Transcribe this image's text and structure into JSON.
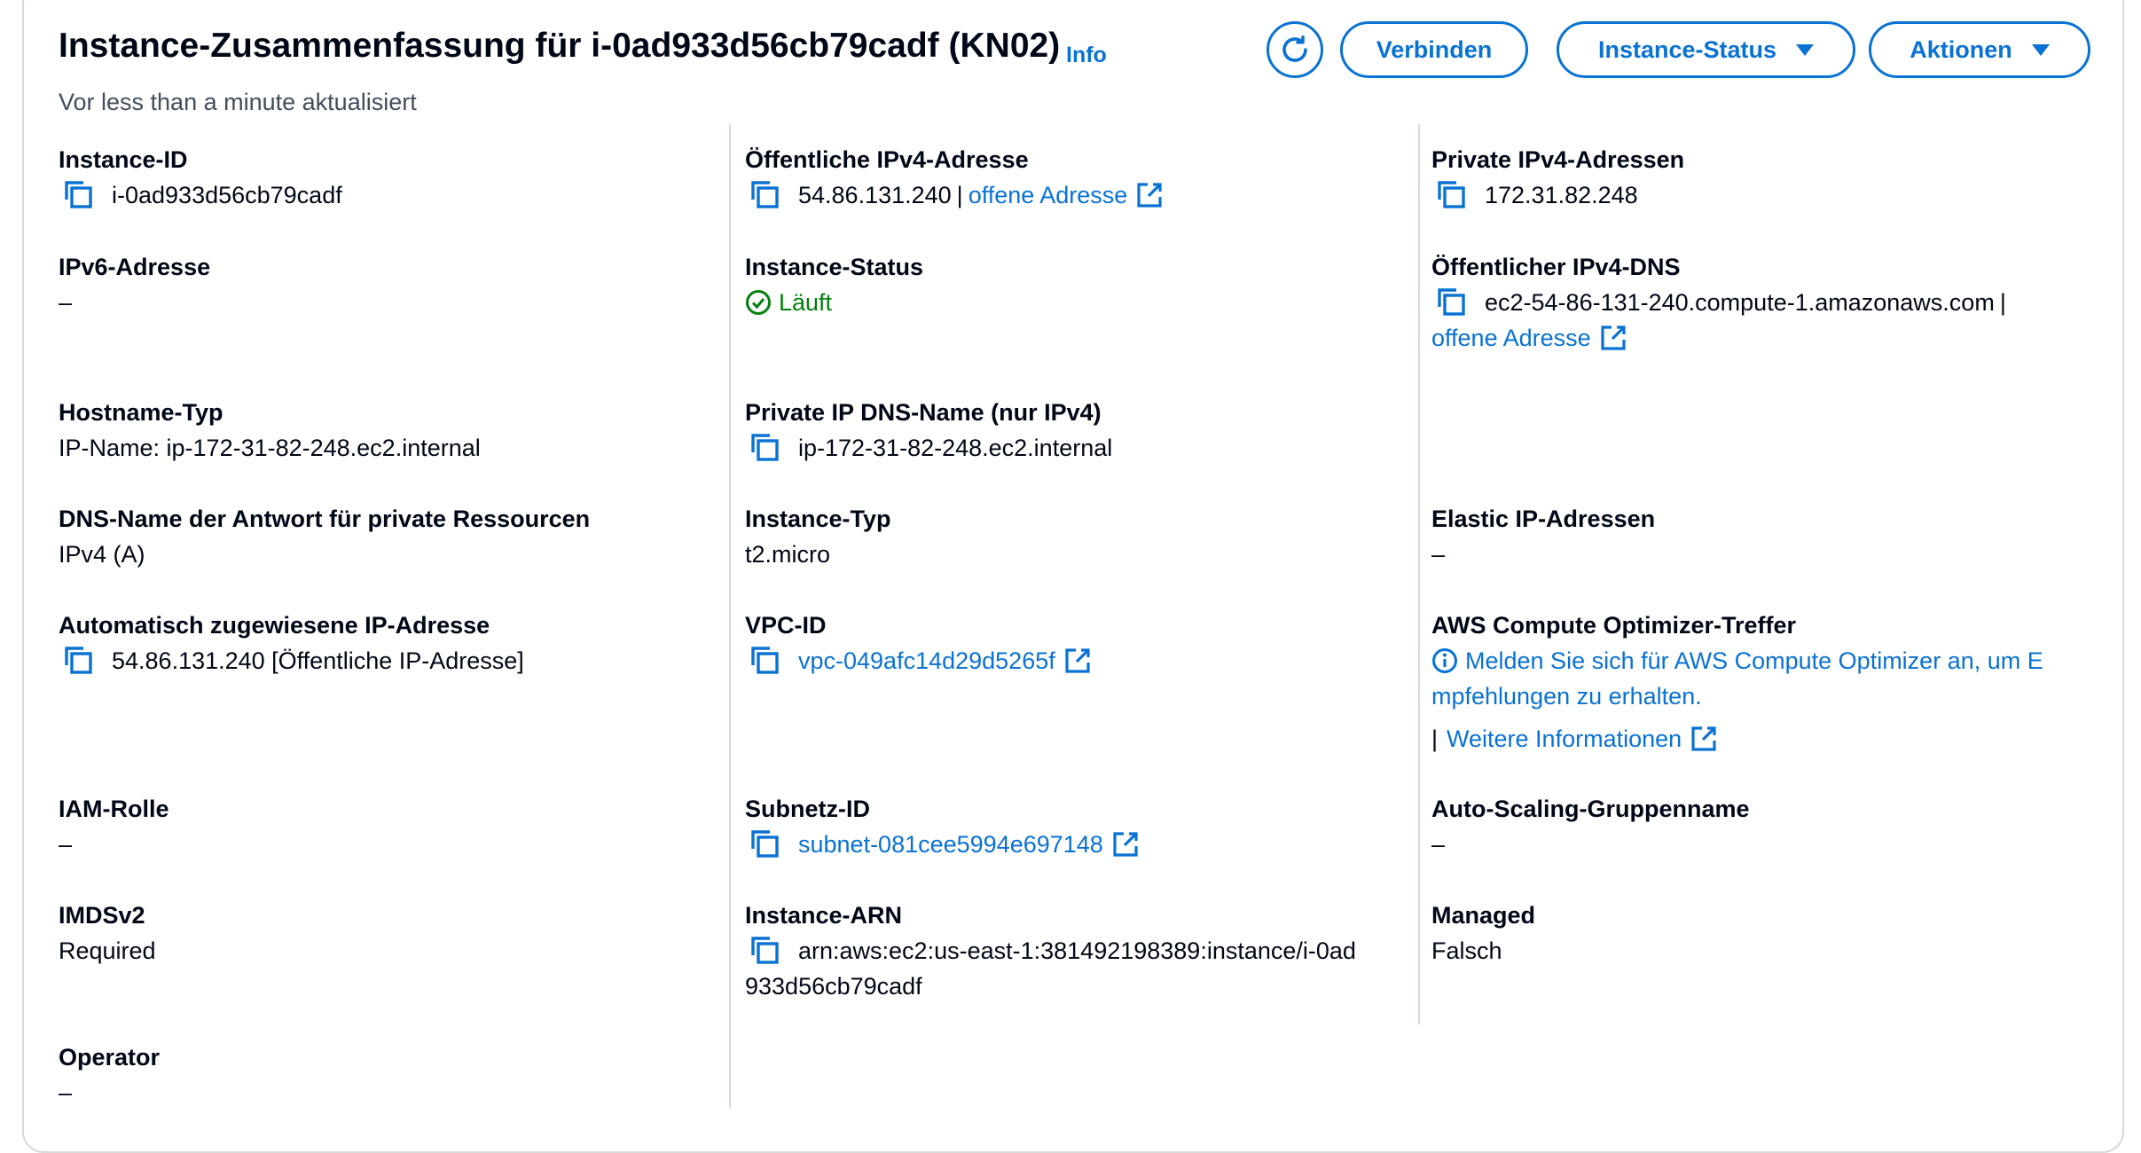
{
  "header": {
    "title": "Instance-Zusammenfassung für i-0ad933d56cb79cadf (KN02)",
    "info": "Info",
    "updated": "Vor less than a minute aktualisiert"
  },
  "actions": {
    "connect": "Verbinden",
    "instance_state": "Instance-Status",
    "actions": "Aktionen"
  },
  "col1": {
    "instance_id": {
      "label": "Instance-ID",
      "value": "i-0ad933d56cb79cadf"
    },
    "ipv6": {
      "label": "IPv6-Adresse",
      "value": "–"
    },
    "hostname_type": {
      "label": "Hostname-Typ",
      "value": "IP-Name: ip-172-31-82-248.ec2.internal"
    },
    "dns_answer": {
      "label": "DNS-Name der Antwort für private Ressourcen",
      "value": "IPv4 (A)"
    },
    "auto_ip": {
      "label": "Automatisch zugewiesene IP-Adresse",
      "value": "54.86.131.240 [Öffentliche IP-Adresse]"
    },
    "iam": {
      "label": "IAM-Rolle",
      "value": "–"
    },
    "imds": {
      "label": "IMDSv2",
      "value": "Required"
    },
    "operator": {
      "label": "Operator",
      "value": "–"
    }
  },
  "col2": {
    "public_ipv4": {
      "label": "Öffentliche IPv4-Adresse",
      "value": "54.86.131.240",
      "sep": "|",
      "link": "offene Adresse"
    },
    "instance_status": {
      "label": "Instance-Status",
      "value": "Läuft"
    },
    "private_dns": {
      "label": "Private IP DNS-Name (nur IPv4)",
      "value": "ip-172-31-82-248.ec2.internal"
    },
    "instance_type": {
      "label": "Instance-Typ",
      "value": "t2.micro"
    },
    "vpc": {
      "label": "VPC-ID",
      "value": "vpc-049afc14d29d5265f"
    },
    "subnet": {
      "label": "Subnetz-ID",
      "value": "subnet-081cee5994e697148"
    },
    "arn": {
      "label": "Instance-ARN",
      "value_line1": "arn:aws:ec2:us-east-1:381492198389:instance/i-0ad",
      "value_line2": "933d56cb79cadf"
    }
  },
  "col3": {
    "private_ipv4": {
      "label": "Private IPv4-Adressen",
      "value": "172.31.82.248"
    },
    "public_dns": {
      "label": "Öffentlicher IPv4-DNS",
      "value": "ec2-54-86-131-240.compute-1.amazonaws.com",
      "sep": "|",
      "link": "offene Adresse"
    },
    "elastic_ip": {
      "label": "Elastic IP-Adressen",
      "value": "–"
    },
    "optimizer": {
      "label": "AWS Compute Optimizer-Treffer",
      "line1": "Melden Sie sich für AWS Compute Optimizer an, um E",
      "line2": "mpfehlungen zu erhalten.",
      "sep": "|",
      "more": "Weitere Informationen"
    },
    "asg": {
      "label": "Auto-Scaling-Gruppenname",
      "value": "–"
    },
    "managed": {
      "label": "Managed",
      "value": "Falsch"
    }
  },
  "colors": {
    "link": "#0972d3",
    "success": "#037f0c",
    "divider": "#d5dbdb"
  }
}
